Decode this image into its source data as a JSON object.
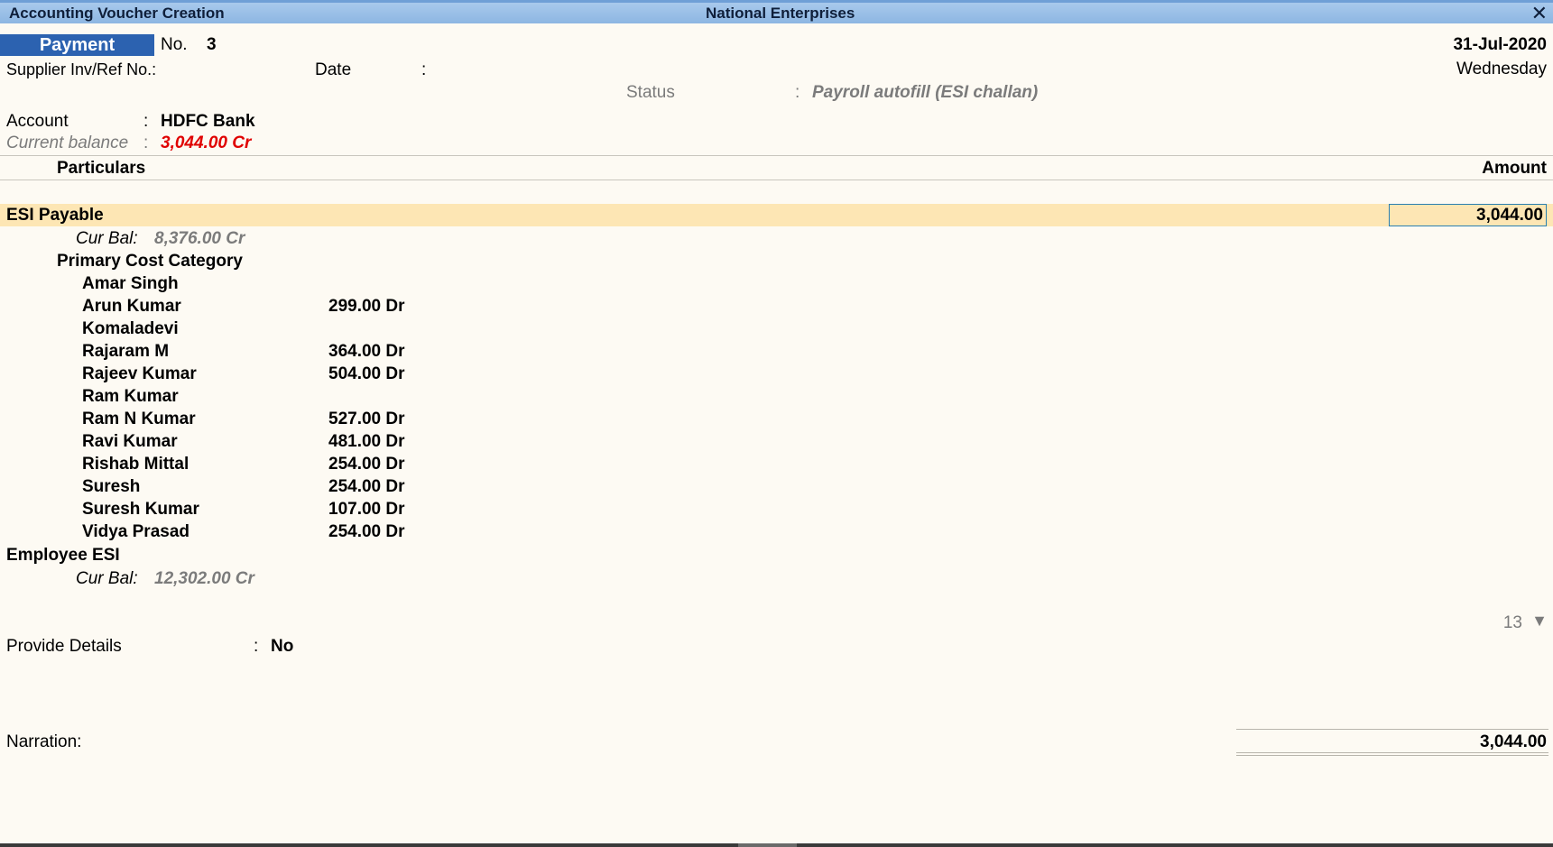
{
  "window": {
    "title": "Accounting Voucher Creation",
    "company": "National Enterprises",
    "close_glyph": "✕"
  },
  "voucher": {
    "type": "Payment",
    "no_label": "No.",
    "no_value": "3",
    "date_value": "31-Jul-2020",
    "day": "Wednesday",
    "supplier_label": "Supplier Inv/Ref No.:",
    "date_label": "Date",
    "date_colon": ":",
    "status_label": "Status",
    "status_colon": ":",
    "status_value": "Payroll autofill (ESI challan)"
  },
  "account": {
    "label": "Account",
    "colon": ":",
    "value": "HDFC Bank",
    "balance_label": "Current balance",
    "balance_colon": ":",
    "balance_value": "3,044.00 Cr"
  },
  "table": {
    "particulars_header": "Particulars",
    "amount_header": "Amount"
  },
  "ledger1": {
    "name": "ESI Payable",
    "amount": "3,044.00",
    "curbal_label": "Cur Bal:",
    "curbal_value": "8,376.00 Cr",
    "cost_category": "Primary Cost Category",
    "cost_centres": [
      {
        "name": "Amar Singh",
        "amount": ""
      },
      {
        "name": "Arun Kumar",
        "amount": "299.00 Dr"
      },
      {
        "name": "Komaladevi",
        "amount": ""
      },
      {
        "name": "Rajaram M",
        "amount": "364.00 Dr"
      },
      {
        "name": "Rajeev Kumar",
        "amount": "504.00 Dr"
      },
      {
        "name": "Ram Kumar",
        "amount": ""
      },
      {
        "name": "Ram N Kumar",
        "amount": "527.00 Dr"
      },
      {
        "name": "Ravi Kumar",
        "amount": "481.00 Dr"
      },
      {
        "name": "Rishab Mittal",
        "amount": "254.00 Dr"
      },
      {
        "name": "Suresh",
        "amount": "254.00 Dr"
      },
      {
        "name": "Suresh Kumar",
        "amount": "107.00 Dr"
      },
      {
        "name": "Vidya Prasad",
        "amount": "254.00 Dr"
      }
    ]
  },
  "ledger2": {
    "name": "Employee ESI",
    "curbal_label": "Cur Bal:",
    "curbal_value": "12,302.00 Cr"
  },
  "scroll_count": "13",
  "scroll_glyph": "▼",
  "provide_details": {
    "label": "Provide Details",
    "colon": ":",
    "value": "No"
  },
  "narration": {
    "label": "Narration:",
    "total": "3,044.00"
  }
}
